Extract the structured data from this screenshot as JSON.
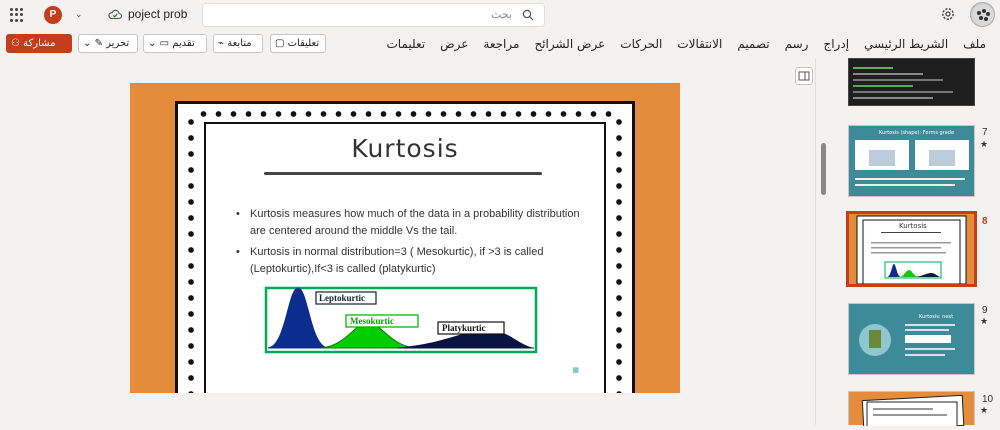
{
  "app": {
    "logo_letter": "P",
    "doc_title": "poject prob",
    "search_placeholder": "بحث"
  },
  "ribbon": {
    "tabs": [
      "ملف",
      "الشريط الرئيسي",
      "إدراج",
      "رسم",
      "تصميم",
      "الانتقالات",
      "الحركات",
      "عرض الشرائح",
      "مراجعة",
      "عرض",
      "تعليمات"
    ],
    "share_label": "مشاركة",
    "edit_label": "تحرير",
    "present_label": "تقديم",
    "catchup_label": "متابعة",
    "comments_label": "تعليقات"
  },
  "slide": {
    "title": "Kurtosis",
    "bullets": [
      "Kurtosis measures how much of the data in a probability distribution are centered around the middle Vs the tail.",
      "Kurtosis in normal distribution=3 ( Mesokurtic), if >3  is called (Leptokurtic),If<3 is called (platykurtic)"
    ],
    "chart_labels": {
      "lepto": "Leptokurtic",
      "meso": "Mesokurtic",
      "platy": "Platykurtic"
    }
  },
  "thumbnails": [
    {
      "num": "7",
      "title": "Kurtosis (shape): Forms grade",
      "color": "#3d8b99"
    },
    {
      "num": "8",
      "title": "Kurtosis",
      "color": "#e48b3c",
      "selected": true
    },
    {
      "num": "9",
      "title": "Kurtosis: next",
      "color": "#3d8b99"
    },
    {
      "num": "10",
      "title": "",
      "color": "#e48b3c"
    }
  ],
  "colors": {
    "accent": "#c43e1c",
    "slide_bg": "#e48b3c"
  }
}
